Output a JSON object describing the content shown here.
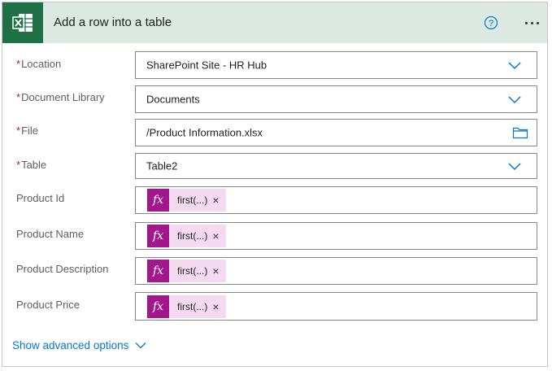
{
  "header": {
    "title": "Add a row into a table",
    "app_icon": "excel-icon",
    "brand_color": "#1e7145"
  },
  "fields": [
    {
      "label": "Location",
      "required": true,
      "value": "SharePoint Site - HR Hub",
      "control": "dropdown"
    },
    {
      "label": "Document Library",
      "required": true,
      "value": "Documents",
      "control": "dropdown"
    },
    {
      "label": "File",
      "required": true,
      "value": "/Product Information.xlsx",
      "control": "file-picker"
    },
    {
      "label": "Table",
      "required": true,
      "value": "Table2",
      "control": "dropdown"
    },
    {
      "label": "Product Id",
      "required": false,
      "token": "first(...)",
      "control": "expression"
    },
    {
      "label": "Product Name",
      "required": false,
      "token": "first(...)",
      "control": "expression"
    },
    {
      "label": "Product Description",
      "required": false,
      "token": "first(...)",
      "control": "expression"
    },
    {
      "label": "Product Price",
      "required": false,
      "token": "first(...)",
      "control": "expression"
    }
  ],
  "required_marker": "*",
  "token_fx": "fx",
  "token_remove": "×",
  "advanced_label": "Show advanced options"
}
